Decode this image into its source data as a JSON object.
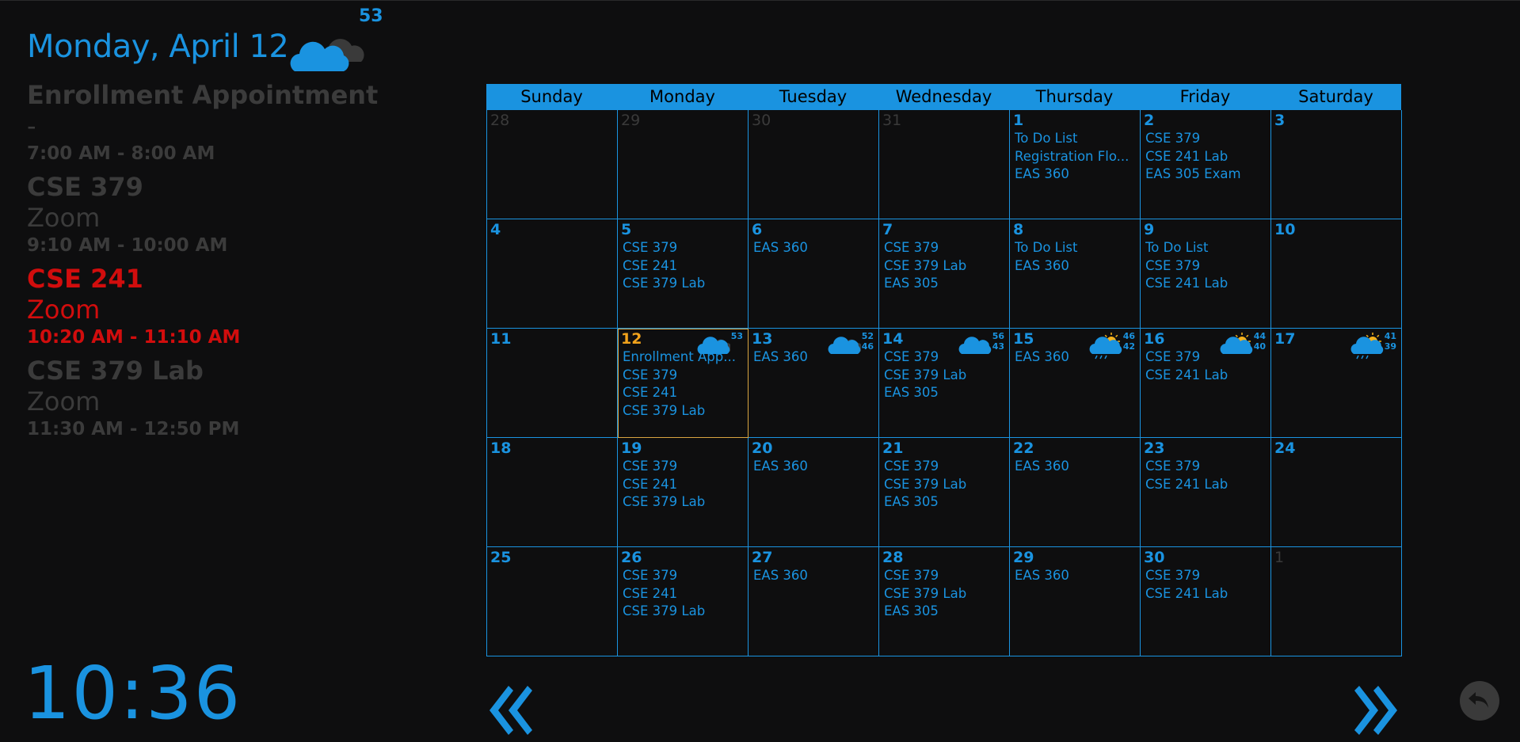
{
  "header": {
    "date_label": "Monday, April 12",
    "temp": "53",
    "weather_icon": "cloudy-icon"
  },
  "events": [
    {
      "title": "Enrollment Appointment",
      "location": "-",
      "time": "7:00 AM - 8:00 AM",
      "state": "past"
    },
    {
      "title": "CSE 379",
      "location": "Zoom",
      "time": "9:10 AM - 10:00 AM",
      "state": "past"
    },
    {
      "title": "CSE 241",
      "location": "Zoom",
      "time": "10:20 AM - 11:10 AM",
      "state": "now"
    },
    {
      "title": "CSE 379 Lab",
      "location": "Zoom",
      "time": "11:30 AM - 12:50 PM",
      "state": "past"
    }
  ],
  "clock": "10:36",
  "calendar": {
    "weekdays": [
      "Sunday",
      "Monday",
      "Tuesday",
      "Wednesday",
      "Thursday",
      "Friday",
      "Saturday"
    ],
    "days": [
      {
        "n": "28",
        "other": true,
        "events": []
      },
      {
        "n": "29",
        "other": true,
        "events": []
      },
      {
        "n": "30",
        "other": true,
        "events": []
      },
      {
        "n": "31",
        "other": true,
        "events": []
      },
      {
        "n": "1",
        "events": [
          "To Do List",
          "Registration Flo...",
          "EAS 360"
        ]
      },
      {
        "n": "2",
        "events": [
          "CSE 379",
          "CSE 241 Lab",
          "EAS 305 Exam"
        ]
      },
      {
        "n": "3",
        "events": []
      },
      {
        "n": "4",
        "events": []
      },
      {
        "n": "5",
        "events": [
          "CSE 379",
          "CSE 241",
          "CSE 379 Lab"
        ]
      },
      {
        "n": "6",
        "events": [
          "EAS 360"
        ]
      },
      {
        "n": "7",
        "events": [
          "CSE 379",
          "CSE 379 Lab",
          "EAS 305"
        ]
      },
      {
        "n": "8",
        "events": [
          "To Do List",
          "EAS 360"
        ]
      },
      {
        "n": "9",
        "events": [
          "To Do List",
          "CSE 379",
          "CSE 241 Lab"
        ]
      },
      {
        "n": "10",
        "events": []
      },
      {
        "n": "11",
        "events": []
      },
      {
        "n": "12",
        "today": true,
        "events": [
          "Enrollment App...",
          "CSE 379",
          "CSE 241",
          "CSE 379 Lab"
        ],
        "weather": {
          "icon": "cloudy-icon",
          "hi": "53",
          "lo": ""
        }
      },
      {
        "n": "13",
        "events": [
          "EAS 360"
        ],
        "weather": {
          "icon": "cloudy-icon",
          "hi": "52",
          "lo": "46"
        }
      },
      {
        "n": "14",
        "events": [
          "CSE 379",
          "CSE 379 Lab",
          "EAS 305"
        ],
        "weather": {
          "icon": "cloud-icon",
          "hi": "56",
          "lo": "43"
        }
      },
      {
        "n": "15",
        "events": [
          "EAS 360"
        ],
        "weather": {
          "icon": "sun-rain-icon",
          "hi": "46",
          "lo": "42"
        }
      },
      {
        "n": "16",
        "events": [
          "CSE 379",
          "CSE 241 Lab"
        ],
        "weather": {
          "icon": "sun-cloud-icon",
          "hi": "44",
          "lo": "40"
        }
      },
      {
        "n": "17",
        "events": [],
        "weather": {
          "icon": "sun-rain-icon",
          "hi": "41",
          "lo": "39"
        }
      },
      {
        "n": "18",
        "events": []
      },
      {
        "n": "19",
        "events": [
          "CSE 379",
          "CSE 241",
          "CSE 379 Lab"
        ]
      },
      {
        "n": "20",
        "events": [
          "EAS 360"
        ]
      },
      {
        "n": "21",
        "events": [
          "CSE 379",
          "CSE 379 Lab",
          "EAS 305"
        ]
      },
      {
        "n": "22",
        "events": [
          "EAS 360"
        ]
      },
      {
        "n": "23",
        "events": [
          "CSE 379",
          "CSE 241 Lab"
        ]
      },
      {
        "n": "24",
        "events": []
      },
      {
        "n": "25",
        "events": []
      },
      {
        "n": "26",
        "events": [
          "CSE 379",
          "CSE 241",
          "CSE 379 Lab"
        ]
      },
      {
        "n": "27",
        "events": [
          "EAS 360"
        ]
      },
      {
        "n": "28",
        "events": [
          "CSE 379",
          "CSE 379 Lab",
          "EAS 305"
        ]
      },
      {
        "n": "29",
        "events": [
          "EAS 360"
        ]
      },
      {
        "n": "30",
        "events": [
          "CSE 379",
          "CSE 241 Lab"
        ]
      },
      {
        "n": "1",
        "other": true,
        "events": []
      }
    ]
  },
  "nav": {
    "prev_icon": "double-chevron-left-icon",
    "next_icon": "double-chevron-right-icon",
    "back_icon": "undo-icon"
  },
  "colors": {
    "accent": "#1a93e0",
    "active": "#d10d0d",
    "past": "#3b3b3b",
    "today": "#f0a21c",
    "bg": "#0e0e0f"
  }
}
